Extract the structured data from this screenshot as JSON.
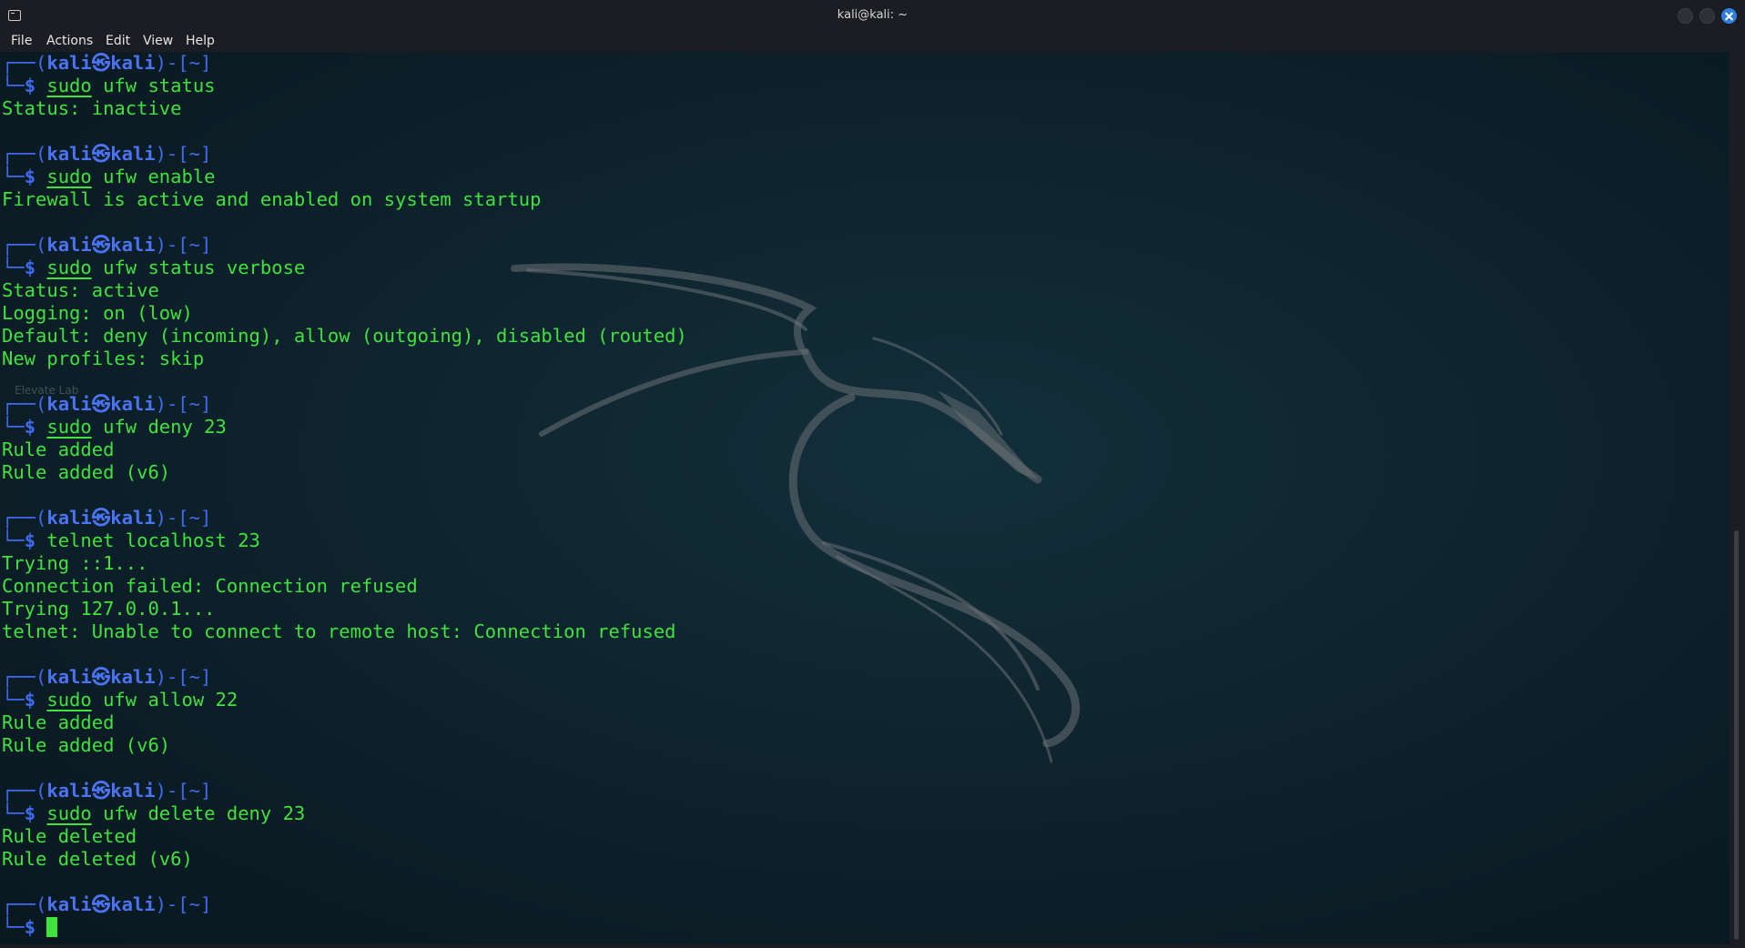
{
  "window": {
    "title": "kali@kali: ~",
    "app_icon": "terminal-icon",
    "controls": [
      "minimize-icon",
      "maximize-icon",
      "close-icon"
    ]
  },
  "menu": {
    "items": [
      "File",
      "Actions",
      "Edit",
      "View",
      "Help"
    ]
  },
  "prompt": {
    "frame_top": "┌──(",
    "user": "kali",
    "at": "㉿",
    "host": "kali",
    "dir_part": ")-[~]",
    "frame_bottom": "└─",
    "dollar": "$"
  },
  "watermark": "Elevate Lab",
  "colors": {
    "output_green": "#3fe23f",
    "prompt_blue": "#3e6bf2",
    "close_button": "#2f7fe2"
  },
  "session": [
    {
      "cmd_sudo": "sudo",
      "cmd_rest": " ufw status",
      "output": [
        "Status: inactive"
      ]
    },
    {
      "cmd_sudo": "sudo",
      "cmd_rest": " ufw enable",
      "output": [
        "Firewall is active and enabled on system startup"
      ]
    },
    {
      "cmd_sudo": "sudo",
      "cmd_rest": " ufw status verbose",
      "output": [
        "Status: active",
        "Logging: on (low)",
        "Default: deny (incoming), allow (outgoing), disabled (routed)",
        "New profiles: skip"
      ]
    },
    {
      "cmd_sudo": "sudo",
      "cmd_rest": " ufw deny 23",
      "output": [
        "Rule added",
        "Rule added (v6)"
      ]
    },
    {
      "cmd_sudo": "",
      "cmd_rest": "telnet localhost 23",
      "output": [
        "Trying ::1...",
        "Connection failed: Connection refused",
        "Trying 127.0.0.1...",
        "telnet: Unable to connect to remote host: Connection refused"
      ]
    },
    {
      "cmd_sudo": "sudo",
      "cmd_rest": " ufw allow 22",
      "output": [
        "Rule added",
        "Rule added (v6)"
      ]
    },
    {
      "cmd_sudo": "sudo",
      "cmd_rest": " ufw delete deny 23",
      "output": [
        "Rule deleted",
        "Rule deleted (v6)"
      ]
    },
    {
      "cmd_sudo": "",
      "cmd_rest": "",
      "output": [],
      "active": true
    }
  ]
}
